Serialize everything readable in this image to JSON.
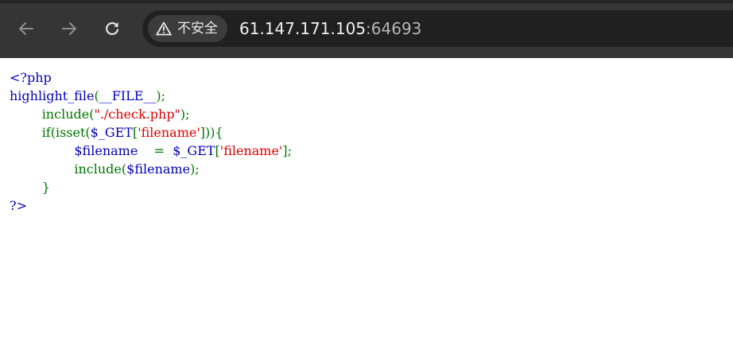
{
  "browser": {
    "security_label": "不安全",
    "url_host": "61.147.171.105",
    "url_port": ":64693",
    "icons": {
      "back": "arrow-left-icon",
      "forward": "arrow-right-icon",
      "reload": "reload-icon",
      "security": "warning-triangle-icon"
    }
  },
  "code": {
    "colors": {
      "default": "#0000bb",
      "keyword": "#007700",
      "string": "#dd0000"
    },
    "lines": [
      {
        "indent": "",
        "tokens": [
          {
            "t": "<?php",
            "c": "default"
          }
        ]
      },
      {
        "indent": "",
        "tokens": [
          {
            "t": "highlight_file",
            "c": "default"
          },
          {
            "t": "(",
            "c": "keyword"
          },
          {
            "t": "__FILE__",
            "c": "default"
          },
          {
            "t": ");",
            "c": "keyword"
          }
        ]
      },
      {
        "indent": "        ",
        "tokens": [
          {
            "t": "include(",
            "c": "keyword"
          },
          {
            "t": "\"./check.php\"",
            "c": "string"
          },
          {
            "t": ");",
            "c": "keyword"
          }
        ]
      },
      {
        "indent": "        ",
        "tokens": [
          {
            "t": "if(isset(",
            "c": "keyword"
          },
          {
            "t": "$_GET",
            "c": "default"
          },
          {
            "t": "[",
            "c": "keyword"
          },
          {
            "t": "'filename'",
            "c": "string"
          },
          {
            "t": "])){",
            "c": "keyword"
          }
        ]
      },
      {
        "indent": "                ",
        "tokens": [
          {
            "t": "$filename    ",
            "c": "default"
          },
          {
            "t": "= ",
            "c": "keyword"
          },
          {
            "t": " $_GET",
            "c": "default"
          },
          {
            "t": "[",
            "c": "keyword"
          },
          {
            "t": "'filename'",
            "c": "string"
          },
          {
            "t": "];",
            "c": "keyword"
          }
        ]
      },
      {
        "indent": "                ",
        "tokens": [
          {
            "t": "include(",
            "c": "keyword"
          },
          {
            "t": "$filename",
            "c": "default"
          },
          {
            "t": ");",
            "c": "keyword"
          }
        ]
      },
      {
        "indent": "        ",
        "tokens": [
          {
            "t": "}",
            "c": "keyword"
          }
        ]
      },
      {
        "indent": "",
        "tokens": [
          {
            "t": "?>",
            "c": "default"
          }
        ]
      }
    ]
  }
}
